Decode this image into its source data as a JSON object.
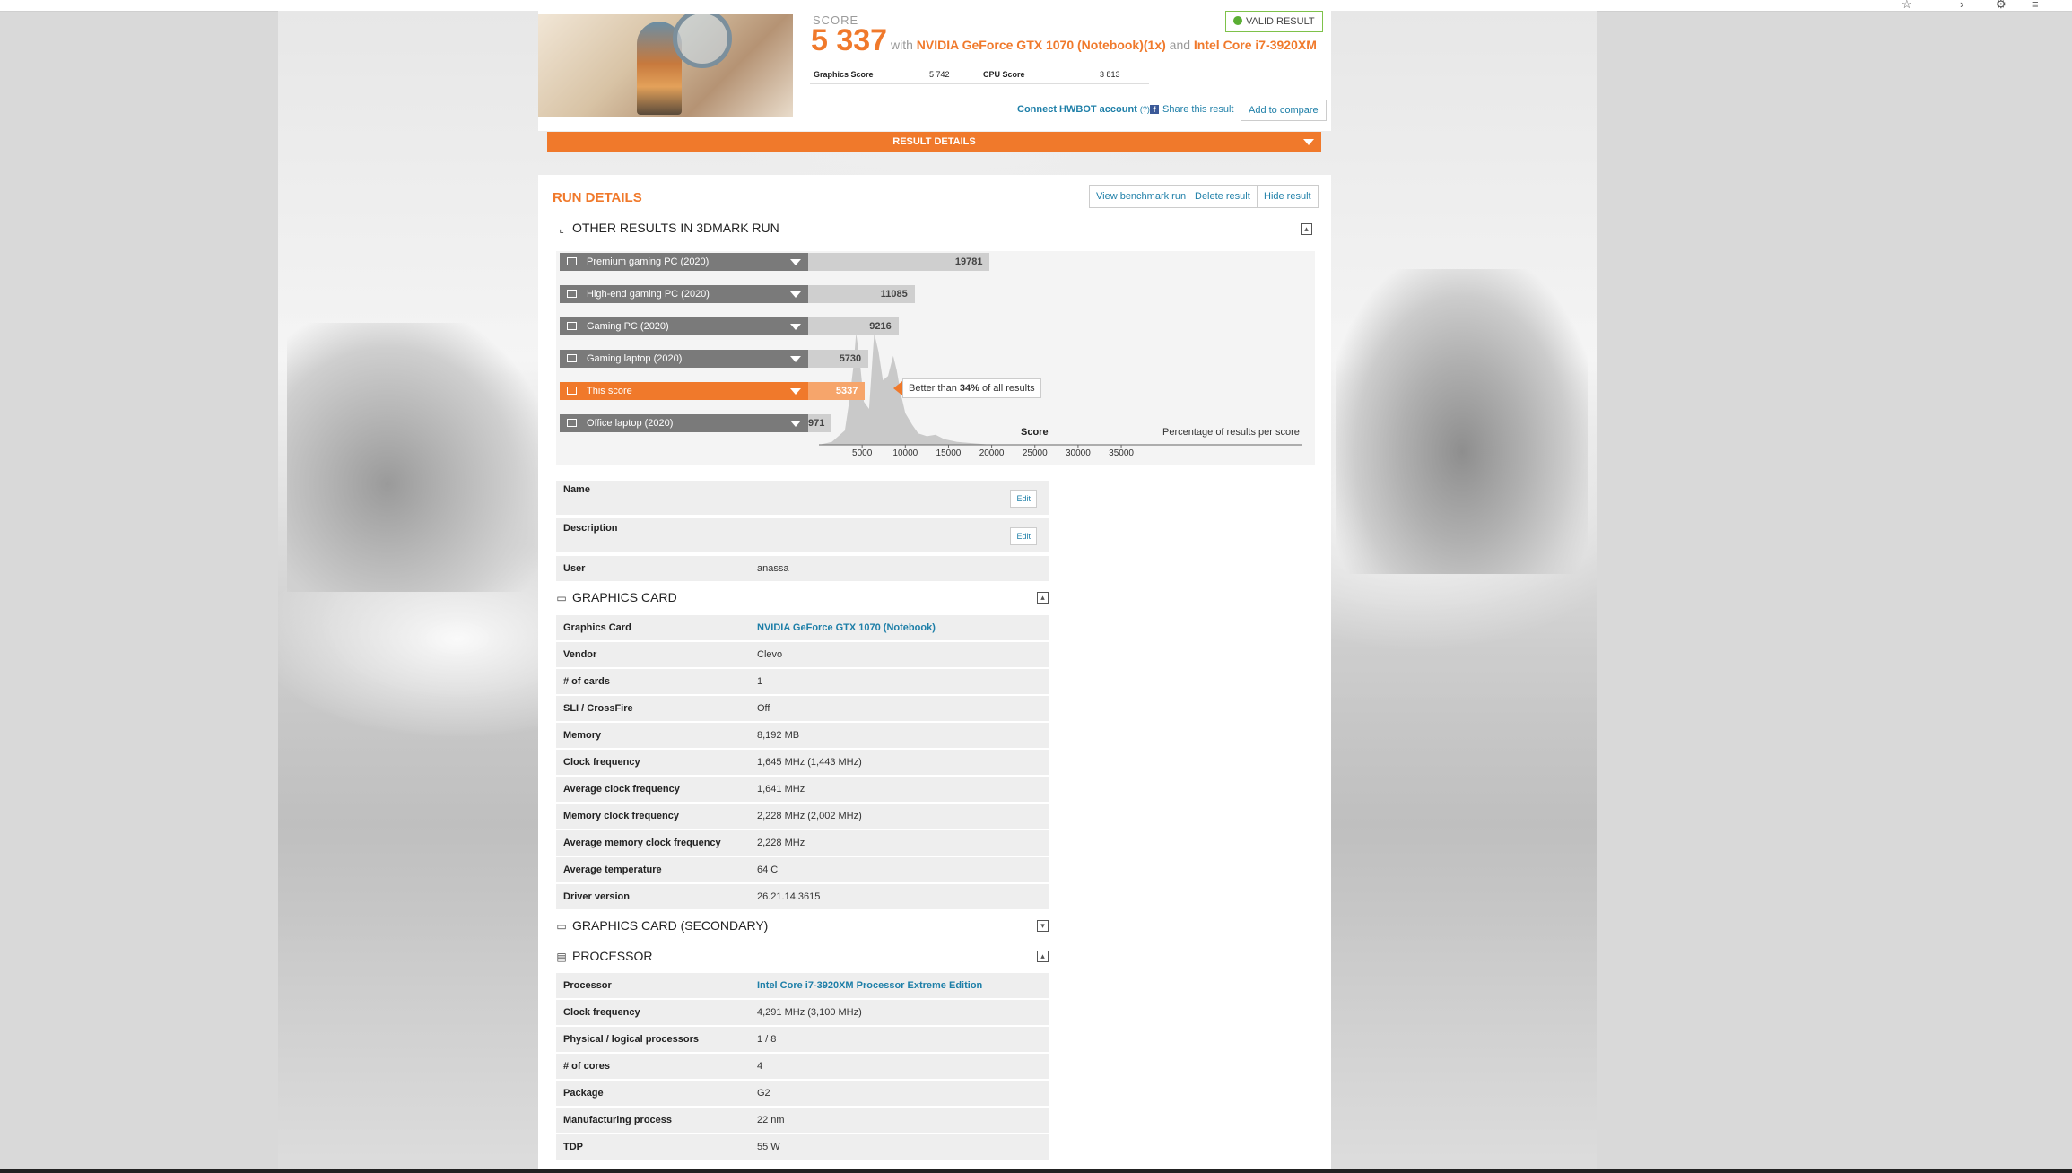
{
  "score_card": {
    "score_label": "SCORE",
    "score_value": "5 337",
    "with_text": "with",
    "gpu": "NVIDIA GeForce GTX 1070 (Notebook)(1x)",
    "and_text": "and",
    "cpu": "Intel Core i7-3920XM",
    "valid_badge": "VALID RESULT",
    "graphics_score_label": "Graphics Score",
    "graphics_score_value": "5 742",
    "cpu_score_label": "CPU Score",
    "cpu_score_value": "3 813",
    "hwbot_link": "Connect HWBOT account",
    "hwbot_help": "(?)",
    "share_link": "Share this result",
    "add_compare": "Add to compare"
  },
  "result_details_bar": "RESULT DETAILS",
  "run_details": {
    "title": "RUN DETAILS",
    "buttons": [
      "View benchmark run",
      "Delete result",
      "Hide result"
    ]
  },
  "other_results": {
    "title": "OTHER RESULTS IN 3DMARK RUN",
    "better_than_prefix": "Better than ",
    "better_than_pct": "34%",
    "better_than_suffix": " of all results",
    "score_axis_label": "Score",
    "pct_label": "Percentage of results per score"
  },
  "chart_data": {
    "type": "bar",
    "categories": [
      "Premium gaming PC (2020)",
      "High-end gaming PC (2020)",
      "Gaming PC (2020)",
      "Gaming laptop (2020)",
      "This score",
      "Office laptop (2020)"
    ],
    "values": [
      19781,
      11085,
      9216,
      5730,
      5337,
      971
    ],
    "value_labels": [
      "19781",
      "11085",
      "9216",
      "5730",
      "5337",
      "971"
    ],
    "highlight_index": 4,
    "xticks": [
      5000,
      10000,
      15000,
      20000,
      25000,
      30000,
      35000
    ],
    "xtick_labels": [
      "5000",
      "10000",
      "15000",
      "20000",
      "25000",
      "30000",
      "35000"
    ],
    "xlim": [
      0,
      38000
    ],
    "xlabel": "Score",
    "ylabel": "Percentage of results per score",
    "distribution": [
      [
        0,
        0
      ],
      [
        1500,
        2
      ],
      [
        3000,
        10
      ],
      [
        3500,
        30
      ],
      [
        4000,
        55
      ],
      [
        4300,
        78
      ],
      [
        4700,
        60
      ],
      [
        5200,
        30
      ],
      [
        5800,
        25
      ],
      [
        6400,
        78
      ],
      [
        6900,
        65
      ],
      [
        7400,
        45
      ],
      [
        8000,
        48
      ],
      [
        8600,
        62
      ],
      [
        9000,
        52
      ],
      [
        9500,
        35
      ],
      [
        10000,
        22
      ],
      [
        10800,
        14
      ],
      [
        11500,
        8
      ],
      [
        12500,
        6
      ],
      [
        13500,
        7
      ],
      [
        14500,
        4
      ],
      [
        16000,
        2
      ],
      [
        18000,
        1
      ],
      [
        20000,
        0
      ],
      [
        38000,
        0
      ]
    ]
  },
  "general": [
    {
      "label": "Name",
      "value": "",
      "edit": "Edit"
    },
    {
      "label": "Description",
      "value": "",
      "edit": "Edit"
    },
    {
      "label": "User",
      "value": "anassa"
    }
  ],
  "graphics_card": {
    "title": "GRAPHICS CARD",
    "rows": [
      {
        "label": "Graphics Card",
        "value": "NVIDIA GeForce GTX 1070 (Notebook)"
      },
      {
        "label": "Vendor",
        "value": "Clevo"
      },
      {
        "label": "# of cards",
        "value": "1"
      },
      {
        "label": "SLI / CrossFire",
        "value": "Off"
      },
      {
        "label": "Memory",
        "value": "8,192 MB"
      },
      {
        "label": "Clock frequency",
        "value": "1,645 MHz (1,443 MHz)"
      },
      {
        "label": "Average clock frequency",
        "value": "1,641 MHz"
      },
      {
        "label": "Memory clock frequency",
        "value": "2,228 MHz (2,002 MHz)"
      },
      {
        "label": "Average memory clock frequency",
        "value": "2,228 MHz"
      },
      {
        "label": "Average temperature",
        "value": "64 C"
      },
      {
        "label": "Driver version",
        "value": "26.21.14.3615"
      }
    ]
  },
  "graphics_card_secondary": {
    "title": "GRAPHICS CARD (SECONDARY)"
  },
  "processor": {
    "title": "PROCESSOR",
    "rows": [
      {
        "label": "Processor",
        "value": "Intel Core i7-3920XM Processor Extreme Edition"
      },
      {
        "label": "Clock frequency",
        "value": "4,291 MHz (3,100 MHz)"
      },
      {
        "label": "Physical / logical processors",
        "value": "1 / 8"
      },
      {
        "label": "# of cores",
        "value": "4"
      },
      {
        "label": "Package",
        "value": "G2"
      },
      {
        "label": "Manufacturing process",
        "value": "22 nm"
      },
      {
        "label": "TDP",
        "value": "55 W"
      }
    ]
  },
  "colors": {
    "accent": "#f0792b",
    "link": "#1e7fa8",
    "valid": "#5aae33",
    "bar_grey": "#7a7a7a"
  }
}
